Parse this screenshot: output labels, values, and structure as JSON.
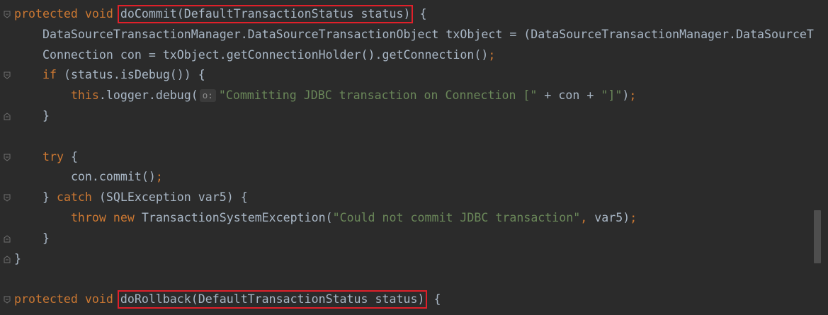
{
  "code_lines": [
    {
      "indent": "",
      "tokens": [
        {
          "t": "kw",
          "v": "protected void "
        },
        {
          "t": "hl",
          "v": "doCommit(DefaultTransactionStatus status)"
        },
        {
          "t": "plain",
          "v": " {"
        }
      ]
    },
    {
      "indent": "    ",
      "tokens": [
        {
          "t": "plain",
          "v": "DataSourceTransactionManager.DataSourceTransactionObject txObject = (DataSourceTransactionManager.DataSourceTr"
        }
      ]
    },
    {
      "indent": "    ",
      "tokens": [
        {
          "t": "plain",
          "v": "Connection con = txObject.getConnectionHolder().getConnection()"
        },
        {
          "t": "kw",
          "v": ";"
        }
      ]
    },
    {
      "indent": "    ",
      "tokens": [
        {
          "t": "kw",
          "v": "if "
        },
        {
          "t": "plain",
          "v": "(status.isDebug()) {"
        }
      ]
    },
    {
      "indent": "        ",
      "tokens": [
        {
          "t": "kw",
          "v": "this"
        },
        {
          "t": "plain",
          "v": ".logger.debug("
        },
        {
          "t": "hint",
          "v": "o:"
        },
        {
          "t": "str",
          "v": "\"Committing JDBC transaction on Connection [\""
        },
        {
          "t": "plain",
          "v": " + con + "
        },
        {
          "t": "str",
          "v": "\"]\""
        },
        {
          "t": "plain",
          "v": ")"
        },
        {
          "t": "kw",
          "v": ";"
        }
      ]
    },
    {
      "indent": "    ",
      "tokens": [
        {
          "t": "plain",
          "v": "}"
        }
      ]
    },
    {
      "indent": "",
      "tokens": []
    },
    {
      "indent": "    ",
      "tokens": [
        {
          "t": "kw",
          "v": "try "
        },
        {
          "t": "plain",
          "v": "{"
        }
      ]
    },
    {
      "indent": "        ",
      "tokens": [
        {
          "t": "plain",
          "v": "con.commit()"
        },
        {
          "t": "kw",
          "v": ";"
        }
      ]
    },
    {
      "indent": "    ",
      "tokens": [
        {
          "t": "plain",
          "v": "} "
        },
        {
          "t": "kw",
          "v": "catch "
        },
        {
          "t": "plain",
          "v": "(SQLException var5) {"
        }
      ]
    },
    {
      "indent": "        ",
      "tokens": [
        {
          "t": "kw",
          "v": "throw new "
        },
        {
          "t": "plain",
          "v": "TransactionSystemException("
        },
        {
          "t": "str",
          "v": "\"Could not commit JDBC transaction\""
        },
        {
          "t": "kw",
          "v": ", "
        },
        {
          "t": "plain",
          "v": "var5)"
        },
        {
          "t": "kw",
          "v": ";"
        }
      ]
    },
    {
      "indent": "    ",
      "tokens": [
        {
          "t": "plain",
          "v": "}"
        }
      ]
    },
    {
      "indent": "",
      "tokens": [
        {
          "t": "plain",
          "v": "}"
        }
      ]
    },
    {
      "indent": "",
      "tokens": []
    },
    {
      "indent": "",
      "tokens": [
        {
          "t": "kw",
          "v": "protected void "
        },
        {
          "t": "hl",
          "v": "doRollback(DefaultTransactionStatus status)"
        },
        {
          "t": "plain",
          "v": " {"
        }
      ]
    }
  ],
  "fold_markers": [
    {
      "line": 0,
      "kind": "open"
    },
    {
      "line": 3,
      "kind": "open"
    },
    {
      "line": 5,
      "kind": "close"
    },
    {
      "line": 7,
      "kind": "open"
    },
    {
      "line": 9,
      "kind": "mid"
    },
    {
      "line": 11,
      "kind": "close"
    },
    {
      "line": 12,
      "kind": "close"
    },
    {
      "line": 14,
      "kind": "open"
    }
  ],
  "colors": {
    "background": "#2b2b2b",
    "keyword": "#cc7832",
    "string": "#6a8759",
    "identifier": "#a9b7c6",
    "highlight_box": "#e0202a"
  }
}
